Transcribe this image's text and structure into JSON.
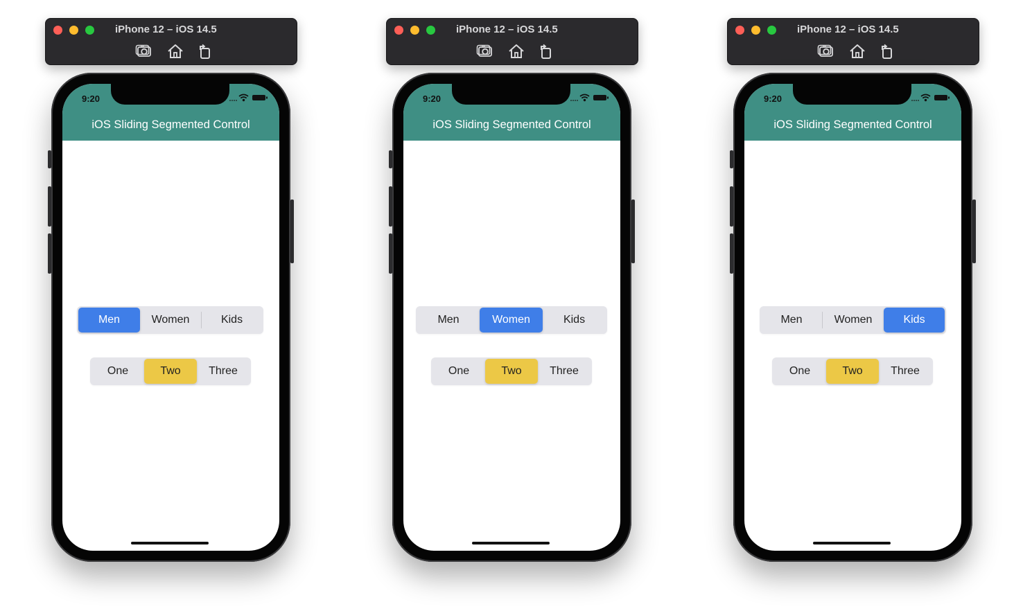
{
  "simulators": [
    {
      "title": "iPhone 12 – iOS 14.5",
      "status_time": "9:20",
      "app_title": "iOS Sliding Segmented Control",
      "gender_segments": [
        "Men",
        "Women",
        "Kids"
      ],
      "selected_gender": "Men",
      "number_segments": [
        "One",
        "Two",
        "Three"
      ],
      "selected_number": "Two"
    },
    {
      "title": "iPhone 12 – iOS 14.5",
      "status_time": "9:20",
      "app_title": "iOS Sliding Segmented Control",
      "gender_segments": [
        "Men",
        "Women",
        "Kids"
      ],
      "selected_gender": "Women",
      "number_segments": [
        "One",
        "Two",
        "Three"
      ],
      "selected_number": "Two"
    },
    {
      "title": "iPhone 12 – iOS 14.5",
      "status_time": "9:20",
      "app_title": "iOS Sliding Segmented Control",
      "gender_segments": [
        "Men",
        "Women",
        "Kids"
      ],
      "selected_gender": "Kids",
      "number_segments": [
        "One",
        "Two",
        "Three"
      ],
      "selected_number": "Two"
    }
  ],
  "colors": {
    "app_bar": "#3f8f84",
    "gender_selected": "#3f7ee8",
    "number_selected": "#ecc846",
    "segment_track": "#e5e5ea"
  },
  "icons": {
    "screenshot": "camera-icon",
    "home": "home-icon",
    "rotate": "rotate-icon",
    "wifi": "wifi-icon",
    "battery": "battery-icon"
  }
}
